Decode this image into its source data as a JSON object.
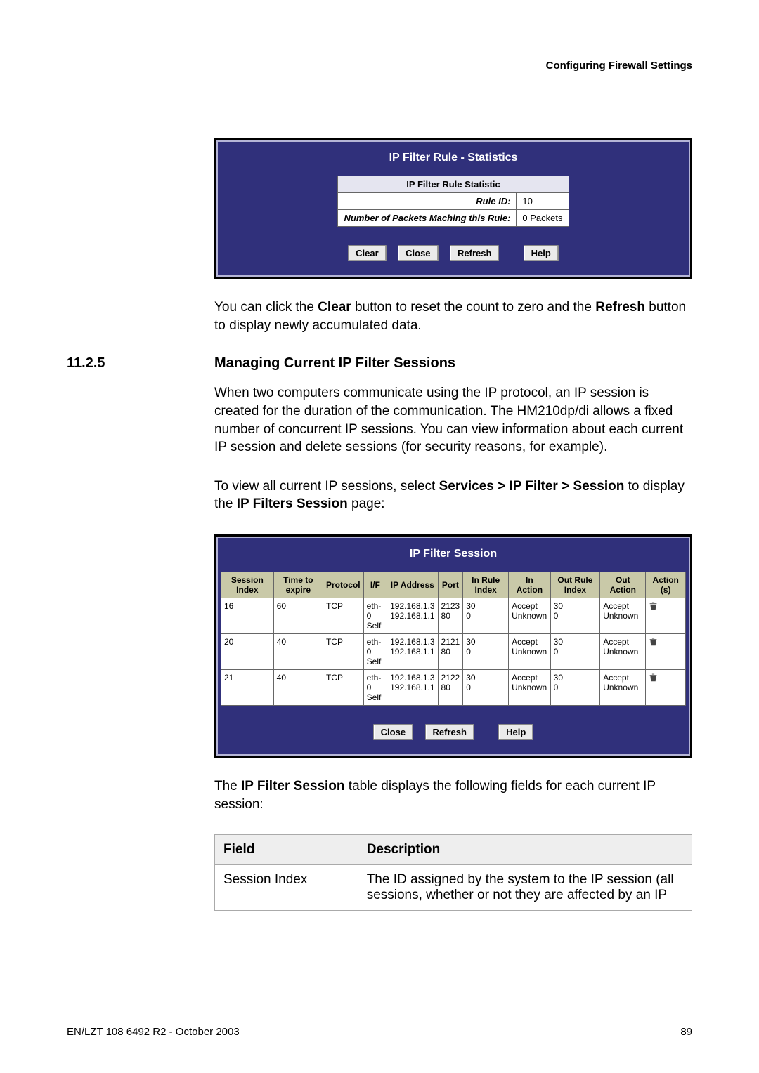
{
  "header": {
    "right": "Configuring Firewall Settings"
  },
  "panel1": {
    "title": "IP Filter Rule - Statistics",
    "subheader": "IP Filter Rule Statistic",
    "rows": [
      {
        "label": "Rule ID:",
        "value": "10"
      },
      {
        "label": "Number of Packets Maching this Rule:",
        "value": "0 Packets"
      }
    ],
    "buttons": {
      "clear": "Clear",
      "close": "Close",
      "refresh": "Refresh",
      "help": "Help"
    }
  },
  "para1_a": "You can click the ",
  "para1_b": "Clear",
  "para1_c": " button to reset the count to zero and the ",
  "para1_d": "Refresh",
  "para1_e": " button to display newly accumulated data.",
  "section": {
    "num": "11.2.5",
    "title": "Managing Current IP Filter Sessions"
  },
  "para2": "When two computers communicate using the IP protocol, an IP session is created for the duration of the communication. The HM210dp/di allows a fixed number of concurrent IP sessions. You can view information about each current IP session and delete sessions (for security reasons, for example).",
  "para3_a": "To view all current IP sessions, select ",
  "para3_b": "Services > IP Filter > Session",
  "para3_c": " to display the ",
  "para3_d": "IP Filters Session",
  "para3_e": " page:",
  "panel2": {
    "title": "IP Filter Session",
    "headers": [
      "Session Index",
      "Time to expire",
      "Protocol",
      "I/F",
      "IP Address",
      "Port",
      "In Rule Index",
      "In Action",
      "Out Rule Index",
      "Out Action",
      "Action (s)"
    ],
    "rows": [
      {
        "sess": "16",
        "tte": "60",
        "proto": "TCP",
        "if": "eth-0\nSelf",
        "ip": "192.168.1.3\n192.168.1.1",
        "port": "2123\n80",
        "iri": "30\n0",
        "ia": "Accept\nUnknown",
        "ori": "30\n0",
        "oa": "Accept\nUnknown"
      },
      {
        "sess": "20",
        "tte": "40",
        "proto": "TCP",
        "if": "eth-0\nSelf",
        "ip": "192.168.1.3\n192.168.1.1",
        "port": "2121\n80",
        "iri": "30\n0",
        "ia": "Accept\nUnknown",
        "ori": "30\n0",
        "oa": "Accept\nUnknown"
      },
      {
        "sess": "21",
        "tte": "40",
        "proto": "TCP",
        "if": "eth-0\nSelf",
        "ip": "192.168.1.3\n192.168.1.1",
        "port": "2122\n80",
        "iri": "30\n0",
        "ia": "Accept\nUnknown",
        "ori": "30\n0",
        "oa": "Accept\nUnknown"
      }
    ],
    "buttons": {
      "close": "Close",
      "refresh": "Refresh",
      "help": "Help"
    }
  },
  "para4_a": "The ",
  "para4_b": "IP Filter Session",
  "para4_c": " table displays the following fields for each current IP session:",
  "desc": {
    "h1": "Field",
    "h2": "Description",
    "r1c1": "Session Index",
    "r1c2": "The ID assigned by the system to the IP session (all sessions, whether or not they are affected by an IP"
  },
  "footer": {
    "left": "EN/LZT 108 6492 R2 - October 2003",
    "right": "89"
  }
}
